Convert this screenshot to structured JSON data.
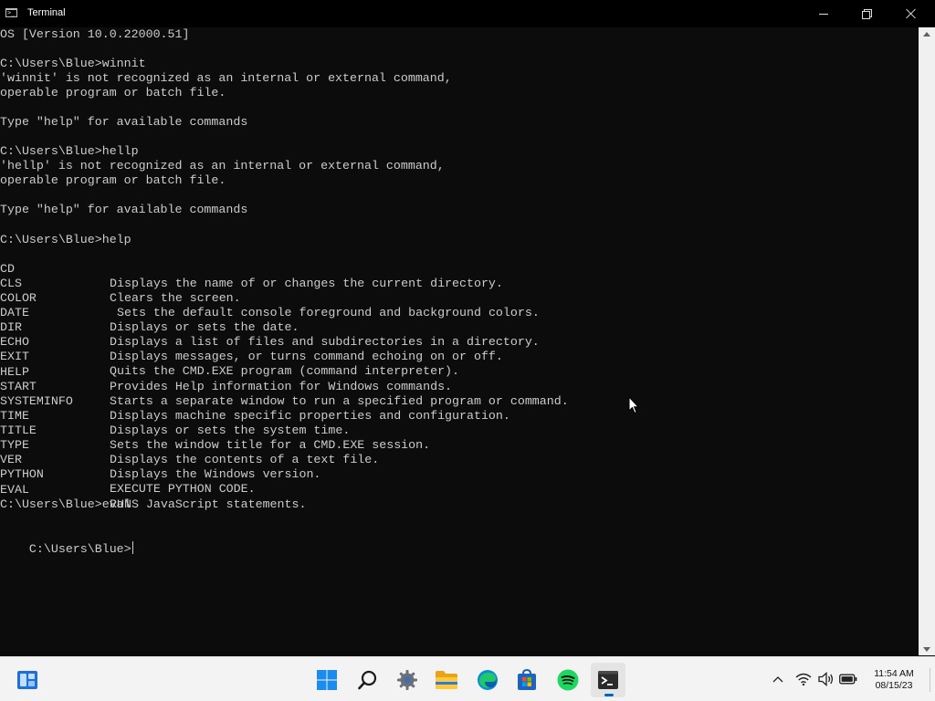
{
  "window": {
    "title": "Terminal",
    "icon": "terminal-app-icon",
    "icon_glyph": ">_",
    "controls": [
      "minimize-icon",
      "maximize-icon",
      "close-icon"
    ]
  },
  "terminal": {
    "text_color": "#cccccc",
    "background": "#0c0c0c",
    "lines": {
      "l0": "OS [Version 10.0.22000.51]",
      "l2": "C:\\Users\\Blue>winnit",
      "l3": "'winnit' is not recognized as an internal or external command,",
      "l4": "operable program or batch file.",
      "l6": "Type \"help\" for available commands",
      "l8": "C:\\Users\\Blue>hellp",
      "l9": "'hellp' is not recognized as an internal or external command,",
      "l10": "operable program or batch file.",
      "l12": "Type \"help\" for available commands",
      "l14": "C:\\Users\\Blue>help",
      "l31": "C:\\Users\\Blue>eval",
      "l33": "C:\\Users\\Blue>"
    },
    "help_table": [
      {
        "cmd": "CD",
        "desc": "Displays the name of or changes the current directory."
      },
      {
        "cmd": "CLS",
        "desc": "Clears the screen."
      },
      {
        "cmd": "COLOR",
        "desc": "Sets the default console foreground and background colors."
      },
      {
        "cmd": "DATE",
        "desc": "Displays or sets the date."
      },
      {
        "cmd": "DIR",
        "desc": "Displays a list of files and subdirectories in a directory."
      },
      {
        "cmd": "ECHO",
        "desc": "Displays messages, or turns command echoing on or off."
      },
      {
        "cmd": "EXIT",
        "desc": "Quits the CMD.EXE program (command interpreter)."
      },
      {
        "cmd": "HELP",
        "desc": "Provides Help information for Windows commands."
      },
      {
        "cmd": "START",
        "desc": "Starts a separate window to run a specified program or command."
      },
      {
        "cmd": "SYSTEMINFO",
        "desc": "Displays machine specific properties and configuration."
      },
      {
        "cmd": "TIME",
        "desc": "Displays or sets the system time."
      },
      {
        "cmd": "TITLE",
        "desc": "Sets the window title for a CMD.EXE session."
      },
      {
        "cmd": "TYPE",
        "desc": "Displays the contents of a text file."
      },
      {
        "cmd": "VER",
        "desc": "Displays the Windows version."
      },
      {
        "cmd": "PYTHON",
        "desc": "EXECUTE PYTHON CODE."
      },
      {
        "cmd": "EVAL",
        "desc": "RUNS JavaScript statements."
      }
    ]
  },
  "scrollbar": {
    "up": "scroll-up-arrow-icon",
    "down": "scroll-down-arrow-icon"
  },
  "taskbar": {
    "widgets": "widgets-icon",
    "apps": [
      "windows-start-icon",
      "search-icon",
      "settings-icon",
      "file-explorer-icon",
      "edge-icon",
      "microsoft-store-icon",
      "spotify-icon",
      "terminal-icon"
    ],
    "active_app": "terminal-icon",
    "accent": "#0067c0",
    "tray": [
      "chevron-up-icon",
      "wifi-icon",
      "volume-icon",
      "battery-icon"
    ],
    "clock": {
      "time": "11:54 AM",
      "date": "08/15/23"
    }
  }
}
